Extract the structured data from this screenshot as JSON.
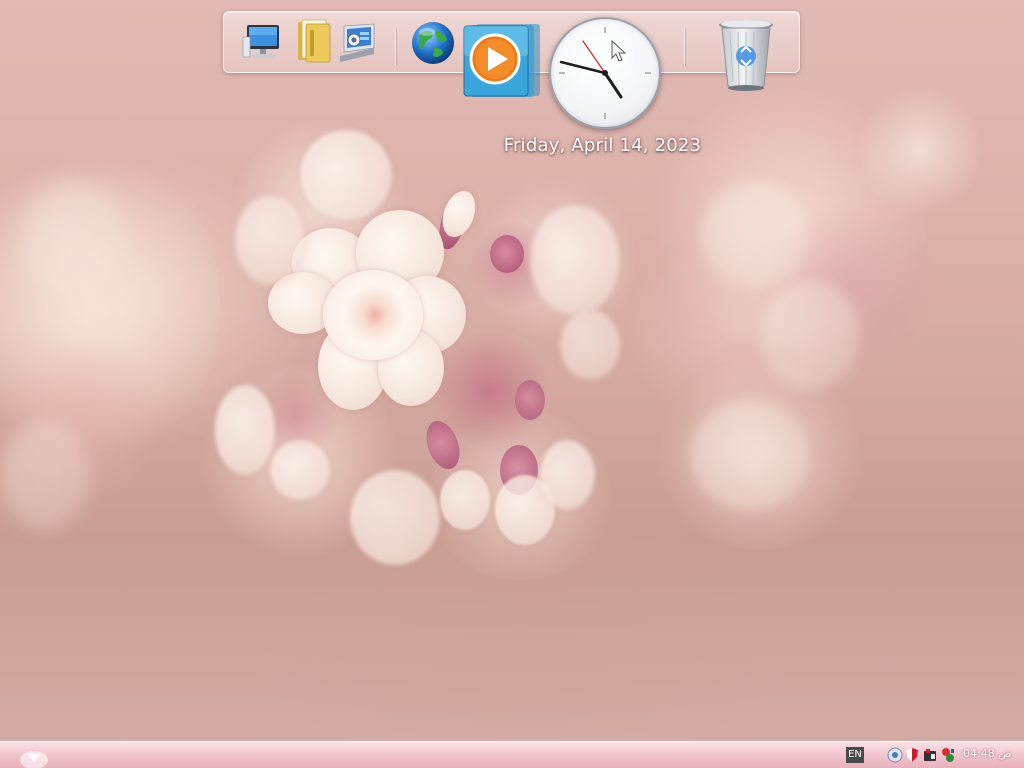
{
  "gadgets": {
    "date_text": "Friday, April 14, 2023",
    "clock_time": "04:48"
  },
  "dock": {
    "items": [
      {
        "name": "Computer",
        "icon": "computer-icon"
      },
      {
        "name": "Documents",
        "icon": "folder-icon"
      },
      {
        "name": "Control Panel",
        "icon": "control-panel-icon"
      },
      {
        "name": "Internet Browser",
        "icon": "globe-icon"
      },
      {
        "name": "Media Player",
        "icon": "media-player-icon"
      },
      {
        "name": "Clock",
        "icon": "clock-icon"
      },
      {
        "name": "Recycle Bin",
        "icon": "recycle-bin-icon"
      }
    ]
  },
  "taskbar": {
    "language": "EN",
    "clock": "04:48 ص",
    "tray_icons": [
      "network-icon",
      "security-shield-icon",
      "tools-icon",
      "flag-icon"
    ]
  },
  "colors": {
    "taskbar": "#f1c3cc",
    "date_text": "#ffffff"
  }
}
